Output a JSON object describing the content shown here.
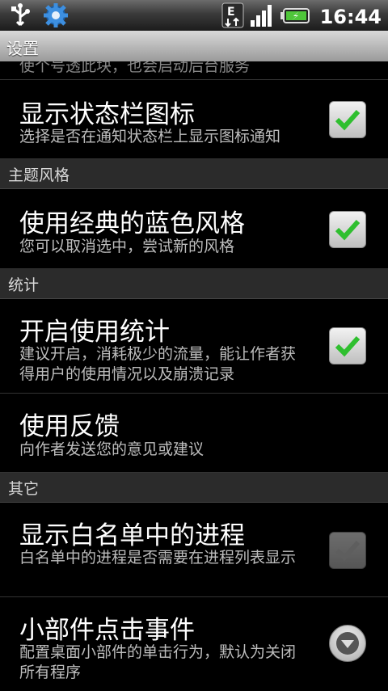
{
  "status_bar": {
    "time": "16:44",
    "icons": [
      "usb-icon",
      "settings-gear-icon",
      "data-e-icon",
      "signal-icon",
      "battery-icon"
    ]
  },
  "title_bar": {
    "title": "设置"
  },
  "sections": {
    "cut_item_text": "使个号透此块，也会启动后台服务",
    "status_bar_icon": {
      "title": "显示状态栏图标",
      "summary": "选择是否在通知状态栏上显示图标通知",
      "checked": true
    },
    "theme_header": "主题风格",
    "classic_blue": {
      "title": "使用经典的蓝色风格",
      "summary": "您可以取消选中，尝试新的风格",
      "checked": true
    },
    "stats_header": "统计",
    "usage_stats": {
      "title": "开启使用统计",
      "summary": "建议开启，消耗极少的流量，能让作者获得用户的使用情况以及崩溃记录",
      "checked": true
    },
    "feedback": {
      "title": "使用反馈",
      "summary": "向作者发送您的意见或建议"
    },
    "other_header": "其它",
    "whitelist": {
      "title": "显示白名单中的进程",
      "summary": "白名单中的进程是否需要在进程列表显示",
      "checked": false
    },
    "widget_click": {
      "title": "小部件点击事件",
      "summary": "配置桌面小部件的单击行为，默认为关闭所有程序"
    }
  },
  "colors": {
    "check_green": "#2fbf2f",
    "header_bg": "#2b2b2b",
    "summary_text": "#bdbdbd"
  }
}
